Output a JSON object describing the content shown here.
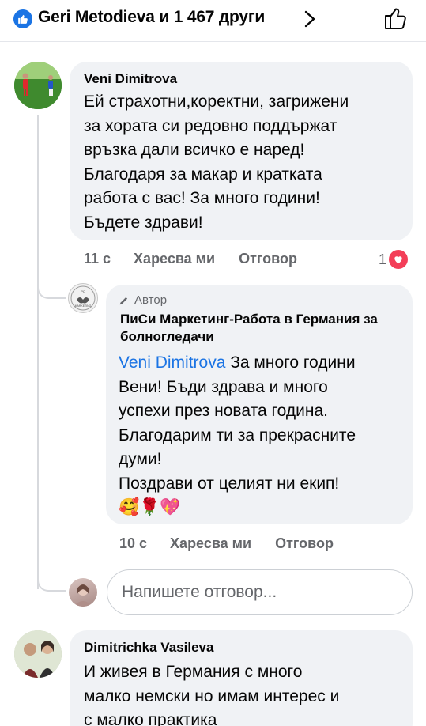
{
  "header": {
    "reactions_text": "Geri Metodieva и 1 467 други",
    "like_badge_color": "#1b74e4"
  },
  "comments": [
    {
      "author": "Veni Dimitrova",
      "text": "Ей страхотни,коректни, загрижени\nза хората си редовно поддържат\nвръзка дали всичко е наред!\nБлагодаря за макар и кратката\nработа с вас! За много години!\nБъдете здрави!",
      "time": "11 с",
      "like_label": "Харесва ми",
      "reply_label": "Отговор",
      "reaction_count": "1",
      "reaction_icon": "heart-icon"
    }
  ],
  "reply": {
    "author_tag": "Автор",
    "author": "ПиСи Маркетинг-Работа в Германия за болногледачи",
    "mention": "Veni Dimitrova",
    "text": " За много години\nВени! Бъди здрава и много\nуспехи през новата година.\nБлагодарим ти за прекрасните\nдуми!\nПоздрави от целият ни екип!",
    "emojis": "🥰🌹💖",
    "time": "10 с",
    "like_label": "Харесва ми",
    "reply_label": "Отговор"
  },
  "reply_box": {
    "placeholder": "Напишете отговор..."
  },
  "next_comment": {
    "author": "Dimitrichka Vasileva",
    "text": "И живея в Германия с много\nмалко  немски но имам интерес и\nс малко  практика"
  },
  "colors": {
    "accent": "#1b74e4",
    "bubble": "#f0f2f5",
    "muted_text": "#65676b",
    "heart": "#f33e58"
  }
}
